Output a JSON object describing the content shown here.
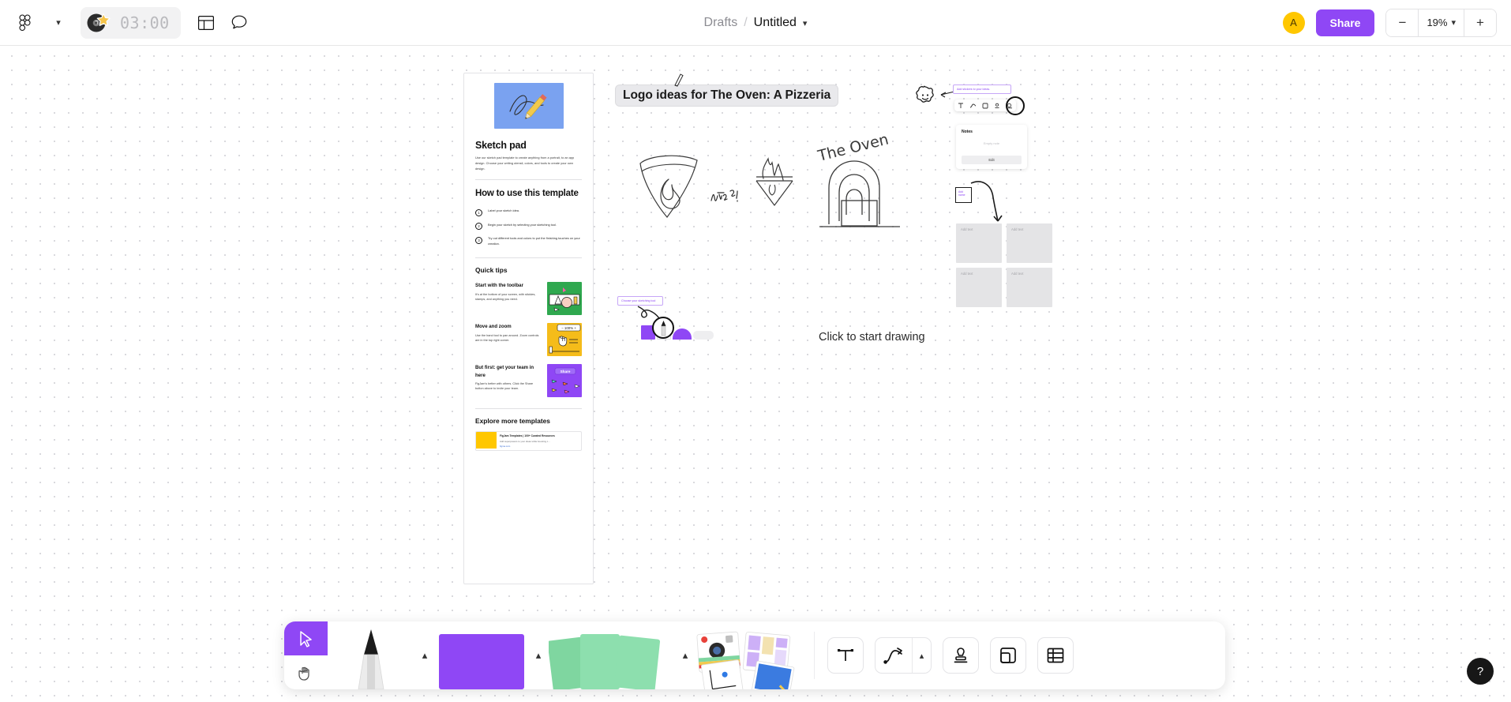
{
  "topbar": {
    "menu_icon": "figma-logo-icon",
    "menu_chevron": "chevron-down-icon",
    "timer": {
      "value": "03:00",
      "icon": "music-star-icon"
    },
    "layout_icon": "layout-panel-icon",
    "comment_icon": "comment-bubble-icon",
    "breadcrumb": {
      "parent": "Drafts",
      "separator": "/",
      "title": "Untitled",
      "chevron": "chevron-down-icon"
    },
    "avatar_initial": "A",
    "share_label": "Share",
    "zoom": {
      "minus": "−",
      "value": "19%",
      "chevron": "chevron-down-icon",
      "plus": "+"
    }
  },
  "sketchpad": {
    "title": "Sketch pad",
    "intro": "Use our sketch pad template to create anything from a portrait, to an app design. Choose your writing utensil, colors, and tools to create your own design.",
    "how_to_title": "How to use this template",
    "steps": [
      {
        "num": "1",
        "text": "Label your sketch idea."
      },
      {
        "num": "2",
        "text": "Begin your sketch by selecting your sketching tool."
      },
      {
        "num": "3",
        "text": "Try out different tools and colors to put the finishing touches on your creation."
      }
    ],
    "quick_tips_title": "Quick tips",
    "tips": [
      {
        "title": "Start with the toolbar",
        "desc": "It's at the bottom of your screen, with stickies, stamps, and anything you need.",
        "thumb": "green"
      },
      {
        "title": "Move and zoom",
        "desc": "Use the hand tool to pan around. Zoom controls are in the top right corner.",
        "thumb": "yellow",
        "badge": "− 100% +"
      },
      {
        "title": "But first: get your team in here",
        "desc": "FigJam's better with others. Click the Share button above to invite your team.",
        "thumb": "purple",
        "badge": "Share"
      }
    ],
    "explore_title": "Explore more templates",
    "link_card": {
      "title": "FigJam Templates | 100+ Curated Resources",
      "desc": "Add superpowers to your ideas while boosting c...",
      "url": "figma.com"
    }
  },
  "canvas": {
    "board_title": "Logo ideas for The Oven: A Pizzeria",
    "hint": "Click to start drawing",
    "sketch_labels": {
      "flame": "Flame?",
      "oven": "The Oven"
    },
    "annotations": {
      "stickers": "Add stickers to your ideas.",
      "sketch_tool": "Choose your sketching tool"
    },
    "notes_widget": {
      "title": "Notes",
      "empty": "Empty note",
      "button": "Edit"
    },
    "sticky_note": "Add name",
    "grid_cards": [
      "Add text",
      "Add text",
      "Add text",
      "Add text"
    ],
    "mini_toolbar_icons": [
      "text-icon",
      "connector-icon",
      "shape-icon",
      "stamp-icon",
      "stickers-icon"
    ]
  },
  "toolbar": {
    "cursor_icon": "cursor-arrow-icon",
    "hand_icon": "hand-pan-icon",
    "pen_icon": "marker-pen-icon",
    "pen_caret": "chevron-up-icon",
    "sticky_icon": "sticky-note-icon",
    "sticky_caret": "chevron-up-icon",
    "shapes_icon": "shapes-icon",
    "shapes_caret": "chevron-up-icon",
    "stickers_icon": "stickers-photos-icon",
    "text_icon": "text-tool-icon",
    "connector_icon": "connector-arrow-icon",
    "connector_caret": "chevron-up-icon",
    "stamp_icon": "stamp-icon",
    "widget_icon": "widget-icon",
    "table_icon": "table-icon"
  },
  "help": {
    "icon": "question-mark-icon",
    "label": "?"
  }
}
